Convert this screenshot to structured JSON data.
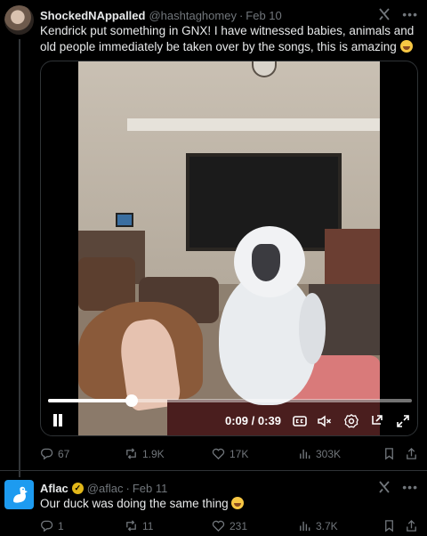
{
  "post1": {
    "display_name": "ShockedNAppalled",
    "handle": "@hashtaghomey",
    "date": "Feb 10",
    "text": "Kendrick put something in GNX! I have witnessed babies, animals and old people immediately be taken over by the songs, this is amazing",
    "video": {
      "current_time": "0:09",
      "duration": "0:39",
      "progress": 0.23
    },
    "stats": {
      "replies": "67",
      "reposts": "1.9K",
      "likes": "17K",
      "views": "303K"
    }
  },
  "post2": {
    "display_name": "Aflac",
    "handle": "@aflac",
    "date": "Feb 11",
    "text": "Our duck was doing the same thing",
    "stats": {
      "replies": "1",
      "reposts": "11",
      "likes": "231",
      "views": "3.7K"
    }
  },
  "common": {
    "separator": "·",
    "time_separator": "/"
  },
  "colors": {
    "background": "#000000",
    "text_primary": "#e7e9ea",
    "text_secondary": "#71767b",
    "verified_gold": "#e2b719",
    "aflac_blue": "#1d9bf0"
  },
  "icons": [
    "grok-icon",
    "more-icon",
    "pause-icon",
    "captions-icon",
    "mute-icon",
    "settings-icon",
    "minimize-icon",
    "fullscreen-icon",
    "reply-icon",
    "repost-icon",
    "like-icon",
    "views-icon",
    "bookmark-icon",
    "share-icon"
  ]
}
